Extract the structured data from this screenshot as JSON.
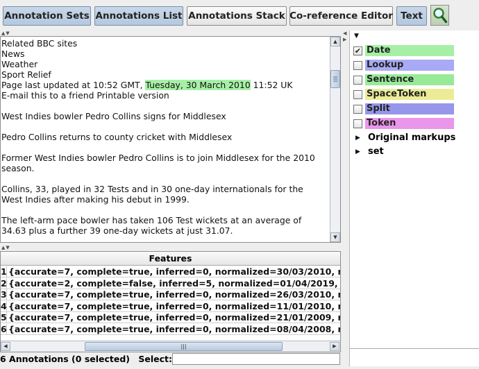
{
  "toolbar": {
    "buttons": [
      {
        "label": "Annotation Sets",
        "active": true
      },
      {
        "label": "Annotations List",
        "active": true
      },
      {
        "label": "Annotations Stack",
        "active": false
      },
      {
        "label": "Co-reference Editor",
        "active": false
      },
      {
        "label": "Text",
        "active": true
      }
    ],
    "search_icon": "magnifier-icon"
  },
  "document": {
    "lines": [
      {
        "text": "Related BBC sites"
      },
      {
        "text": "News"
      },
      {
        "text": "Weather"
      },
      {
        "text": "Sport Relief"
      },
      {
        "pre": "Page last updated at 10:52 GMT, ",
        "highlight": "Tuesday, 30 March 2010",
        "post": " 11:52 UK"
      },
      {
        "text": "E-mail this to a friend Printable version"
      },
      {
        "text": ""
      },
      {
        "text": "West Indies bowler Pedro Collins signs for Middlesex"
      },
      {
        "text": ""
      },
      {
        "text": "Pedro Collins returns to county cricket with Middlesex"
      },
      {
        "text": ""
      },
      {
        "text": "Former West Indies bowler Pedro Collins is to join Middlesex for the 2010"
      },
      {
        "text": "season."
      },
      {
        "text": ""
      },
      {
        "text": "Collins, 33, played in 32 Tests and in 30 one-day internationals for the"
      },
      {
        "text": "West Indies after making his debut in 1999."
      },
      {
        "text": ""
      },
      {
        "text": "The left-arm pace bowler has taken 106 Test wickets at an average of"
      },
      {
        "text": "34.63 plus a further 39 one-day wickets at just 31.07."
      }
    ],
    "highlight_color": "#a6f0a6"
  },
  "table": {
    "header": "Features",
    "rows": [
      {
        "index": "1",
        "features": "{accurate=7, complete=true, inferred=0, normalized=30/03/2010, re"
      },
      {
        "index": "2",
        "features": "{accurate=2, complete=false, inferred=5, normalized=01/04/2019, r"
      },
      {
        "index": "3",
        "features": "{accurate=7, complete=true, inferred=0, normalized=26/03/2010, re"
      },
      {
        "index": "4",
        "features": "{accurate=7, complete=true, inferred=0, normalized=11/01/2010, re"
      },
      {
        "index": "5",
        "features": "{accurate=7, complete=true, inferred=0, normalized=21/01/2009, re"
      },
      {
        "index": "6",
        "features": "{accurate=7, complete=true, inferred=0, normalized=08/04/2008, re"
      }
    ]
  },
  "status": {
    "summary": "6 Annotations (0 selected)",
    "select_label": "Select:",
    "select_value": ""
  },
  "annotation_types": [
    {
      "label": "Date",
      "checked": true,
      "color": "#a6f0a6"
    },
    {
      "label": "Lookup",
      "checked": false,
      "color": "#a8aaf5"
    },
    {
      "label": "Sentence",
      "checked": false,
      "color": "#98ea98"
    },
    {
      "label": "SpaceToken",
      "checked": false,
      "color": "#ecec98"
    },
    {
      "label": "Split",
      "checked": false,
      "color": "#9696ea"
    },
    {
      "label": "Token",
      "checked": false,
      "color": "#ea96ea"
    }
  ],
  "tree_nodes": [
    {
      "label": "Original markups"
    },
    {
      "label": "set"
    }
  ]
}
